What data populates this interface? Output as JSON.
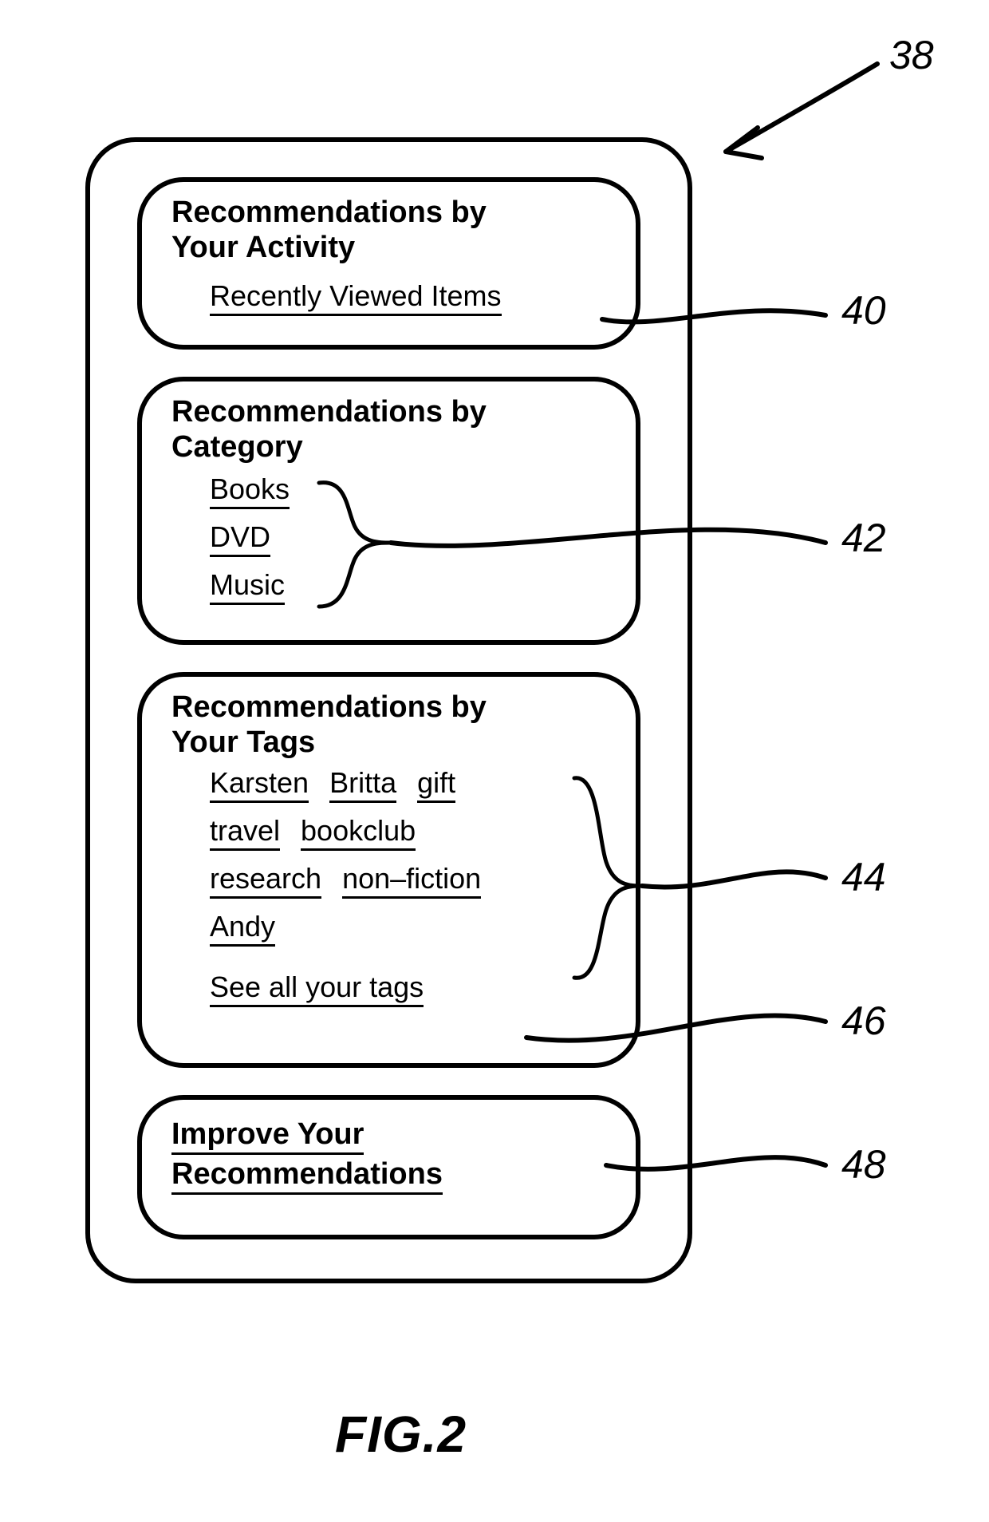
{
  "figure_label": "FIG.2",
  "refs": {
    "outer": "38",
    "activity": "40",
    "category": "42",
    "tags": "44",
    "see_all": "46",
    "improve": "48"
  },
  "activity": {
    "title_line1": "Recommendations by",
    "title_line2": "Your Activity",
    "recent_link": "Recently Viewed Items"
  },
  "category": {
    "title_line1": "Recommendations by",
    "title_line2": "Category",
    "items": {
      "books": "Books",
      "dvd": "DVD",
      "music": "Music"
    }
  },
  "tags": {
    "title_line1": "Recommendations by",
    "title_line2": "Your Tags",
    "tags": {
      "karsten": "Karsten",
      "britta": "Britta",
      "gift": "gift",
      "travel": "travel",
      "bookclub": "bookclub",
      "research": "research",
      "nonfiction": "non–fiction",
      "andy": "Andy"
    },
    "see_all": "See all your tags"
  },
  "improve": {
    "title_line1": "Improve Your",
    "title_line2": "Recommendations"
  }
}
